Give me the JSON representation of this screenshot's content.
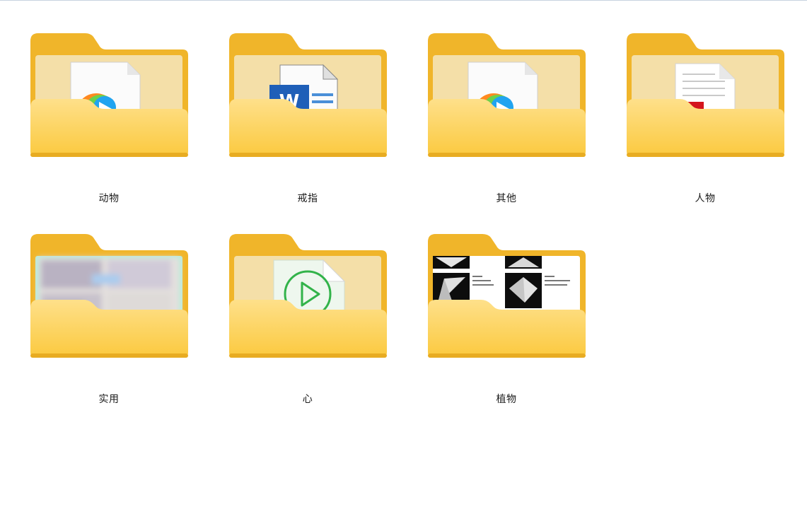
{
  "explorer": {
    "folders": [
      {
        "name": "动物",
        "preview": "video-file-icon"
      },
      {
        "name": "戒指",
        "preview": "word-document-icon"
      },
      {
        "name": "其他",
        "preview": "video-file-icon"
      },
      {
        "name": "人物",
        "preview": "pdf-document-icon"
      },
      {
        "name": "实用",
        "preview": "blurred-image-thumbnail"
      },
      {
        "name": "心",
        "preview": "media-play-file-icon"
      },
      {
        "name": "植物",
        "preview": "paper-folding-image-thumbnail"
      }
    ]
  },
  "colors": {
    "folder_back": "#f0b52a",
    "folder_front": "#fdd668",
    "folder_front_dark": "#f9c23c",
    "paper": "#f4dfa8"
  }
}
